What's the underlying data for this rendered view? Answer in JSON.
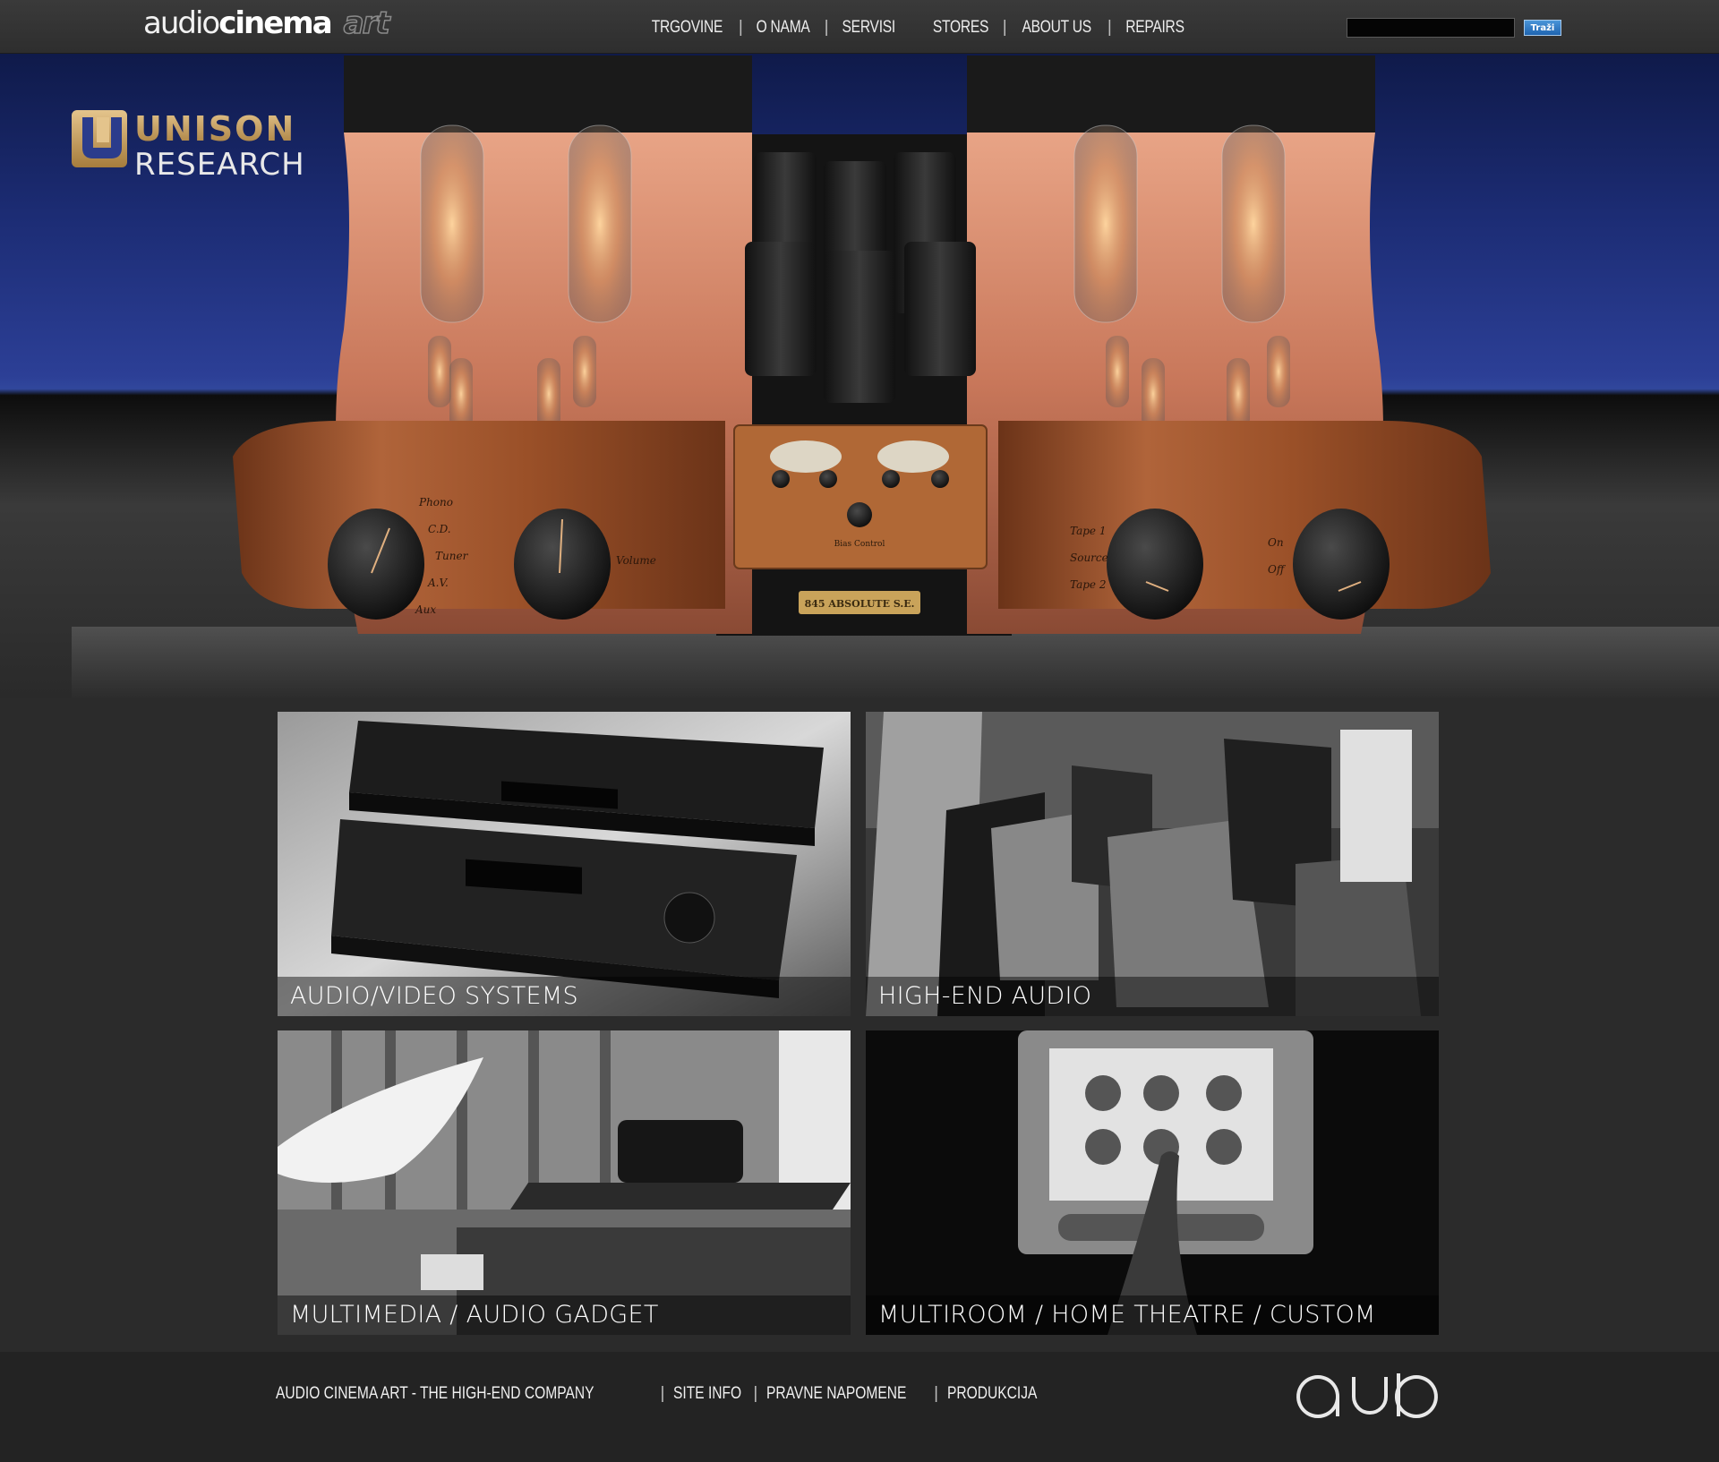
{
  "header": {
    "logo": {
      "part1": "audio",
      "part2": "cinema",
      "part3": "art"
    },
    "nav": [
      {
        "label": "TRGOVINE"
      },
      {
        "label": "O NAMA"
      },
      {
        "label": "SERVISI"
      },
      {
        "label": "STORES"
      },
      {
        "label": "ABOUT US"
      },
      {
        "label": "REPAIRS"
      }
    ],
    "search": {
      "value": "",
      "button_label": "Traži"
    }
  },
  "hero": {
    "brand": {
      "line1": "UNISON",
      "line2": "RESEARCH"
    },
    "amp_labels": {
      "left_selector": [
        "Phono",
        "C.D.",
        "Tuner",
        "A.V.",
        "Aux"
      ],
      "left_knob": "Volume",
      "right_selector": [
        "Tape 1",
        "Source",
        "Tape 2"
      ],
      "right_switch": [
        "On",
        "Off"
      ],
      "bias": "Bias Control",
      "plate": "845 ABSOLUTE S.E."
    }
  },
  "tiles": [
    {
      "label": "AUDIO/VIDEO SYSTEMS"
    },
    {
      "label": "HIGH-END AUDIO"
    },
    {
      "label": "MULTIMEDIA / AUDIO GADGET"
    },
    {
      "label": "MULTIROOM / HOME THEATRE / CUSTOM"
    }
  ],
  "footer": {
    "links": [
      {
        "label": "AUDIO CINEMA ART - THE HIGH-END COMPANY"
      },
      {
        "label": "SITE INFO"
      },
      {
        "label": "PRAVNE NAPOMENE"
      },
      {
        "label": "PRODUKCIJA"
      }
    ]
  },
  "colors": {
    "page_bg": "#2b2b2b",
    "topbar_bg": "#333333",
    "footer_bg": "#232323",
    "hero_blue": "#2c3f96",
    "copper": "#c8775a",
    "wood": "#a0522d",
    "unison_gold": "#c8a163",
    "search_button": "#2a78c8"
  }
}
